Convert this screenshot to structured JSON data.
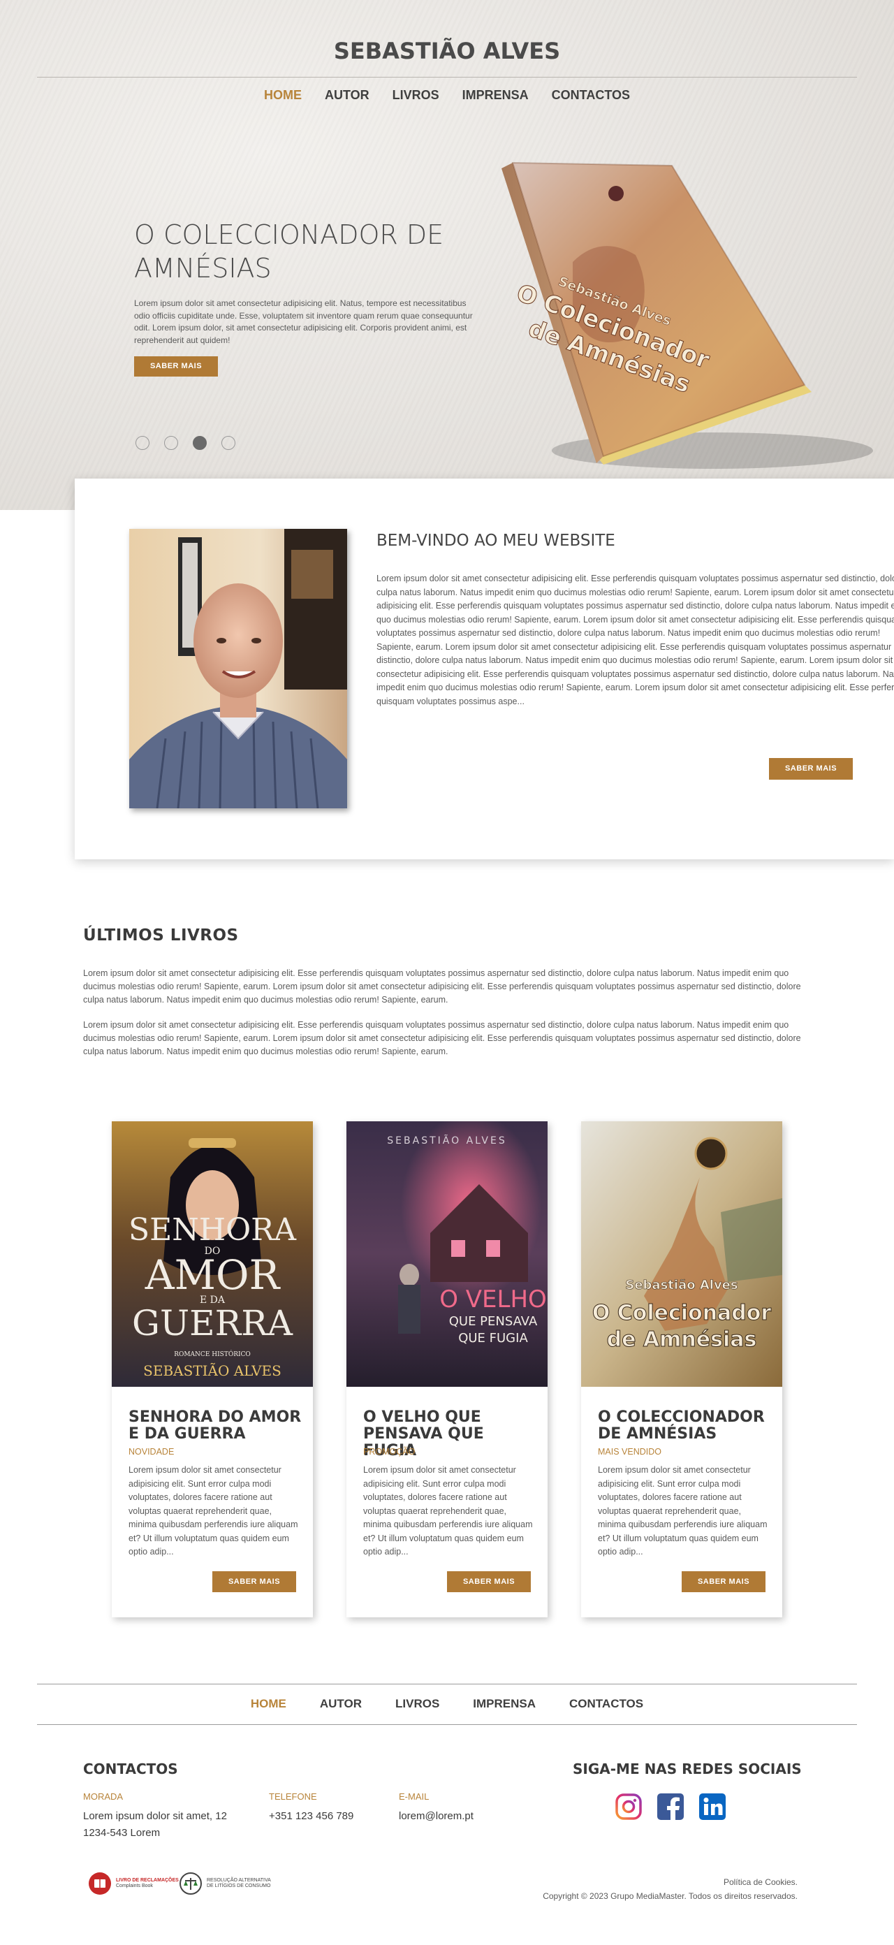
{
  "site": {
    "title": "SEBASTIÃO ALVES"
  },
  "nav": {
    "items": [
      {
        "label": "HOME",
        "active": true
      },
      {
        "label": "AUTOR",
        "active": false
      },
      {
        "label": "LIVROS",
        "active": false
      },
      {
        "label": "IMPRENSA",
        "active": false
      },
      {
        "label": "CONTACTOS",
        "active": false
      }
    ]
  },
  "hero": {
    "heading": "O COLECCIONADOR DE AMNÉSIAS",
    "text": "Lorem ipsum dolor sit amet consectetur adipisicing elit. Natus, tempore est necessitatibus odio officiis cupiditate unde. Esse, voluptatem sit inventore quam rerum quae consequuntur odit. Lorem ipsum dolor, sit amet consectetur adipisicing elit. Corporis provident animi, est reprehenderit aut quidem!",
    "button": "SABER MAIS",
    "slides": 4,
    "active_slide": 3,
    "book_cover": {
      "author": "Sebastião Alves",
      "title_line1": "O Colecionador",
      "title_line2": "de Amnésias"
    }
  },
  "welcome": {
    "title": "BEM-VINDO AO MEU WEBSITE",
    "text": "Lorem ipsum dolor sit amet consectetur adipisicing elit. Esse perferendis quisquam voluptates possimus aspernatur sed distinctio, dolore culpa natus laborum. Natus impedit enim quo ducimus molestias odio rerum! Sapiente, earum. Lorem ipsum dolor sit amet consectetur adipisicing elit. Esse perferendis quisquam voluptates possimus aspernatur sed distinctio, dolore culpa natus laborum. Natus impedit enim quo ducimus molestias odio rerum! Sapiente, earum. Lorem ipsum dolor sit amet consectetur adipisicing elit. Esse perferendis quisquam voluptates possimus aspernatur sed distinctio, dolore culpa natus laborum. Natus impedit enim quo ducimus molestias odio rerum! Sapiente, earum. Lorem ipsum dolor sit amet consectetur adipisicing elit. Esse perferendis quisquam voluptates possimus aspernatur sed distinctio, dolore culpa natus laborum. Natus impedit enim quo ducimus molestias odio rerum! Sapiente, earum. Lorem ipsum dolor sit amet consectetur adipisicing elit. Esse perferendis quisquam voluptates possimus aspernatur sed distinctio, dolore culpa natus laborum. Natus impedit enim quo ducimus molestias odio rerum! Sapiente, earum. Lorem ipsum dolor sit amet consectetur adipisicing elit. Esse perferendis quisquam voluptates possimus aspe...",
    "button": "SABER MAIS"
  },
  "latest": {
    "title": "ÚLTIMOS LIVROS",
    "p1": "Lorem ipsum dolor sit amet consectetur adipisicing elit. Esse perferendis quisquam voluptates possimus aspernatur sed distinctio, dolore culpa natus laborum. Natus impedit enim quo ducimus molestias odio rerum! Sapiente, earum. Lorem ipsum dolor sit amet consectetur adipisicing elit. Esse perferendis quisquam voluptates possimus aspernatur sed distinctio, dolore culpa natus laborum. Natus impedit enim quo ducimus molestias odio rerum! Sapiente, earum.",
    "p2": "Lorem ipsum dolor sit amet consectetur adipisicing elit. Esse perferendis quisquam voluptates possimus aspernatur sed distinctio, dolore culpa natus laborum. Natus impedit enim quo ducimus molestias odio rerum! Sapiente, earum. Lorem ipsum dolor sit amet consectetur adipisicing elit. Esse perferendis quisquam voluptates possimus aspernatur sed distinctio, dolore culpa natus laborum. Natus impedit enim quo ducimus molestias odio rerum! Sapiente, earum."
  },
  "books": [
    {
      "title": "SENHORA DO AMOR E DA GUERRA",
      "tag": "NOVIDADE",
      "desc": "Lorem ipsum dolor sit amet consectetur adipisicing elit. Sunt error culpa modi voluptates, dolores facere ratione aut voluptas quaerat reprehenderit quae, minima quibusdam perferendis iure aliquam et? Ut illum voluptatum quas quidem eum optio adip...",
      "button": "SABER MAIS",
      "cover": {
        "line1": "SENHORA",
        "line2": "DO",
        "line3": "AMOR",
        "line4": "E DA",
        "line5": "GUERRA",
        "genre": "ROMANCE HISTÓRICO",
        "author": "SEBASTIÃO ALVES"
      }
    },
    {
      "title": "O VELHO QUE PENSAVA QUE FUGIA",
      "tag": "PROMOÇÃO",
      "desc": "Lorem ipsum dolor sit amet consectetur adipisicing elit. Sunt error culpa modi voluptates, dolores facere ratione aut voluptas quaerat reprehenderit quae, minima quibusdam perferendis iure aliquam et? Ut illum voluptatum quas quidem eum optio adip...",
      "button": "SABER MAIS",
      "cover": {
        "author": "SEBASTIÃO ALVES",
        "line1": "O VELHO",
        "line2": "QUE PENSAVA",
        "line3": "QUE FUGIA"
      }
    },
    {
      "title": "O COLECCIONADOR DE AMNÉSIAS",
      "tag": "MAIS VENDIDO",
      "desc": "Lorem ipsum dolor sit amet consectetur adipisicing elit. Sunt error culpa modi voluptates, dolores facere ratione aut voluptas quaerat reprehenderit quae, minima quibusdam perferendis iure aliquam et? Ut illum voluptatum quas quidem eum optio adip...",
      "button": "SABER MAIS",
      "cover": {
        "author": "Sebastião Alves",
        "line1": "O Colecionador",
        "line2": "de Amnésias"
      }
    }
  ],
  "footer": {
    "contacts_title": "CONTACTOS",
    "morada_label": "MORADA",
    "morada_value": "Lorem ipsum dolor sit amet, 12 1234-543 Lorem",
    "telefone_label": "TELEFONE",
    "telefone_value": "+351 123 456 789",
    "email_label": "E-MAIL",
    "email_value": "lorem@lorem.pt",
    "social_title": "SIGA-ME NAS REDES SOCIAIS",
    "social_icons": [
      "instagram-icon",
      "facebook-icon",
      "linkedin-icon"
    ],
    "badge1": {
      "brand": "LIVRO DE RECLAMAÇÕES",
      "sub": "Complaints Book"
    },
    "badge2": {
      "line1": "RESOLUÇÃO ALTERNATIVA",
      "line2": "DE LITÍGIOS DE CONSUMO"
    },
    "cookies": "Política de Cookies.",
    "copyright": "Copyright © 2023 Grupo MediaMaster. Todos os direitos reservados."
  },
  "colors": {
    "accent": "#b07a35",
    "accent_text": "#b8843a",
    "text": "#3a3a3a",
    "muted": "#5a5a5a"
  }
}
